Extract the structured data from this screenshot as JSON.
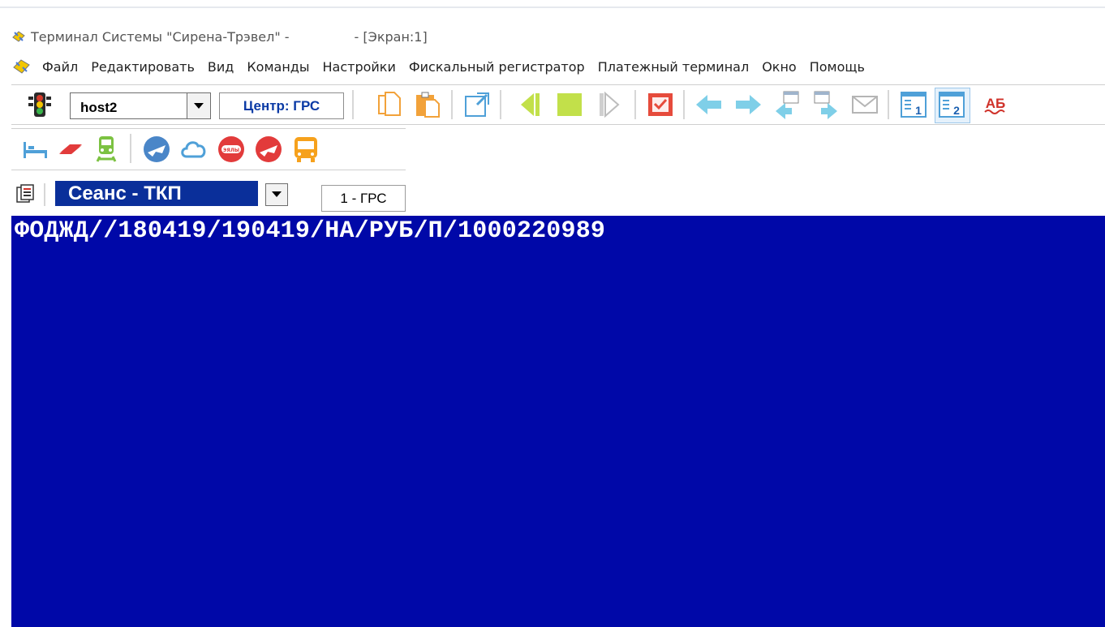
{
  "window": {
    "title_left": "Терминал Системы \"Сирена-Трэвел\" -",
    "title_right": "- [Экран:1]"
  },
  "menu": {
    "items": [
      "Файл",
      "Редактировать",
      "Вид",
      "Команды",
      "Настройки",
      "Фискальный регистратор",
      "Платежный терминал",
      "Окно",
      "Помощь"
    ]
  },
  "toolbar": {
    "host_value": "host2",
    "center_label": "Центр: ГРС",
    "tab1_label": "1",
    "tab2_label": "2",
    "ab_label": "АБ"
  },
  "session": {
    "selected": "Сеанс - ТКП",
    "tab_label": "1 - ГРС"
  },
  "terminal": {
    "line1": "ФОДЖД//180419/190419/НА/РУБ/П/1000220989"
  },
  "colors": {
    "terminal_bg": "#0008a8",
    "terminal_text": "#ffffff",
    "session_bg": "#0a2f9a",
    "center_text": "#0a3aa5"
  }
}
